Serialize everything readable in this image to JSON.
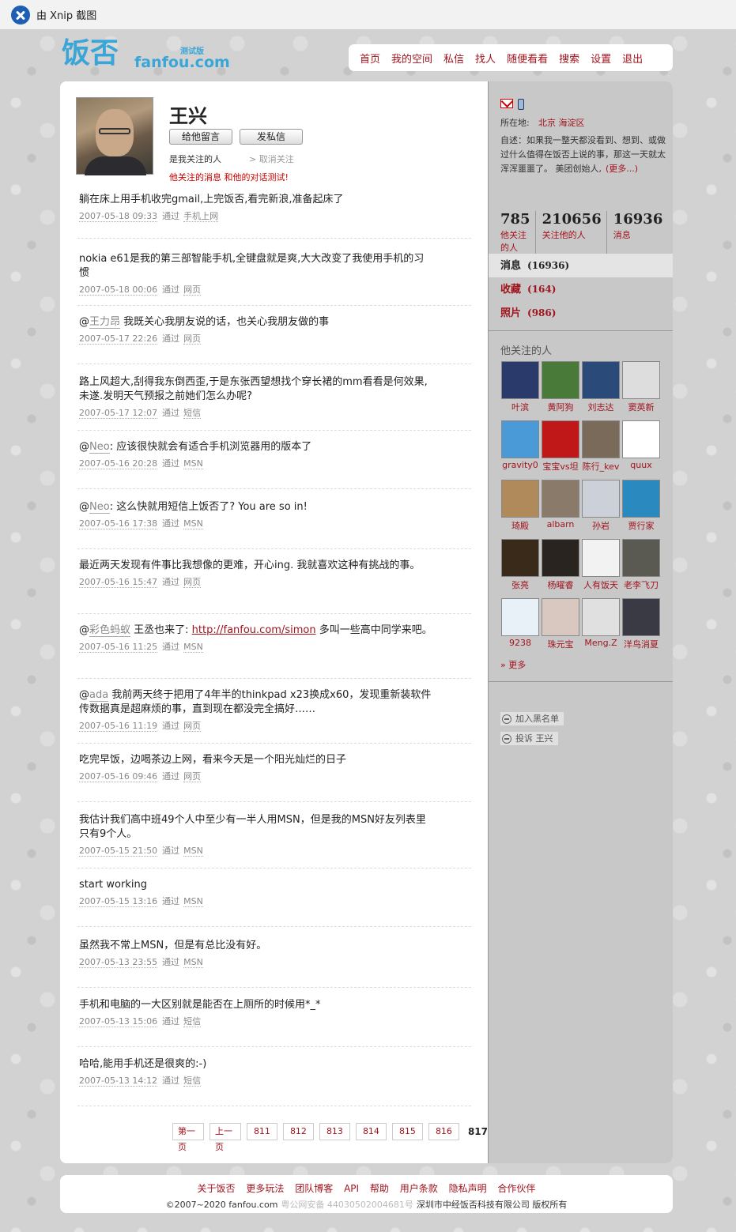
{
  "xnip": {
    "title": "由 Xnip 截图"
  },
  "logo": {
    "cn": "饭否",
    "en": "fanfou.com",
    "beta": "测试版"
  },
  "nav": [
    "首页",
    "我的空间",
    "私信",
    "找人",
    "随便看看",
    "搜索",
    "设置",
    "退出"
  ],
  "profile": {
    "name": "王兴",
    "btn_message": "给他留言",
    "btn_dm": "发私信",
    "follow_status": "是我关注的人",
    "unfollow": "> 取消关注",
    "follow_note": "他关注的消息 和他的对话测试!"
  },
  "statuses": [
    {
      "text": "躺在床上用手机收完gmail,上完饭否,看完新浪,准备起床了",
      "date": "2007-05-18 09:33",
      "via": "通过",
      "src": "手机上网"
    },
    {
      "text": "nokia e61是我的第三部智能手机,全键盘就是爽,大大改变了我使用手机的习惯",
      "date": "2007-05-18 00:06",
      "via": "通过",
      "src": "网页"
    },
    {
      "mention": "王力昂",
      "text": " 我既关心我朋友说的话，也关心我朋友做的事",
      "date": "2007-05-17 22:26",
      "via": "通过",
      "src": "网页"
    },
    {
      "text": "路上风超大,刮得我东倒西歪,于是东张西望想找个穿长裙的mm看看是何效果,未遂.发明天气预报之前她们怎么办呢?",
      "date": "2007-05-17 12:07",
      "via": "通过",
      "src": "短信"
    },
    {
      "mention": "Neo",
      "text": ": 应该很快就会有适合手机浏览器用的版本了",
      "date": "2007-05-16 20:28",
      "via": "通过",
      "src": "MSN"
    },
    {
      "mention": "Neo",
      "text": ": 这么快就用短信上饭否了? You are so in!",
      "date": "2007-05-16 17:38",
      "via": "通过",
      "src": "MSN"
    },
    {
      "text": "最近两天发现有件事比我想像的更难，开心ing. 我就喜欢这种有挑战的事。",
      "date": "2007-05-16 15:47",
      "via": "通过",
      "src": "网页"
    },
    {
      "mention": "彩色蚂蚁",
      "text": " 王丞也来了: ",
      "link": "http://fanfou.com/simon",
      "text2": " 多叫一些高中同学来吧。",
      "date": "2007-05-16 11:25",
      "via": "通过",
      "src": "MSN"
    },
    {
      "mention": "ada",
      "text": " 我前两天终于把用了4年半的thinkpad x23换成x60，发现重新装软件传数据真是超麻烦的事，直到现在都没完全搞好……",
      "date": "2007-05-16 11:19",
      "via": "通过",
      "src": "网页"
    },
    {
      "text": "吃完早饭，边喝茶边上网，看来今天是一个阳光灿烂的日子",
      "date": "2007-05-16 09:46",
      "via": "通过",
      "src": "网页"
    },
    {
      "text": "我估计我们高中班49个人中至少有一半人用MSN，但是我的MSN好友列表里只有9个人。",
      "date": "2007-05-15 21:50",
      "via": "通过",
      "src": "MSN"
    },
    {
      "text": "start working",
      "date": "2007-05-15 13:16",
      "via": "通过",
      "src": "MSN"
    },
    {
      "text": "虽然我不常上MSN，但是有总比没有好。",
      "date": "2007-05-13 23:55",
      "via": "通过",
      "src": "MSN"
    },
    {
      "text": "手机和电脑的一大区别就是能否在上厕所的时候用*_*",
      "date": "2007-05-13 15:06",
      "via": "通过",
      "src": "短信"
    },
    {
      "text": "哈哈,能用手机还是很爽的:-)",
      "date": "2007-05-13 14:12",
      "via": "通过",
      "src": "短信"
    }
  ],
  "pager": {
    "first": "第一页",
    "prev": "上一页",
    "pages": [
      "811",
      "812",
      "813",
      "814",
      "815",
      "816"
    ],
    "current": "817"
  },
  "sidebar": {
    "location_label": "所在地:",
    "location": "北京 海淀区",
    "bio": "自述：如果我一整天都没看到、想到、或做过什么值得在饭否上说的事，那这一天就太浑浑噩噩了。 美团创始人,",
    "bio_more": "(更多...)",
    "stats": [
      {
        "n": "785",
        "l": "他关注的人"
      },
      {
        "n": "210656",
        "l": "关注他的人"
      },
      {
        "n": "16936",
        "l": "消息"
      }
    ],
    "menu": [
      {
        "label": "消息",
        "count": "(16936)"
      },
      {
        "label": "收藏",
        "count": "(164)"
      },
      {
        "label": "照片",
        "count": "(986)"
      }
    ],
    "friends_title": "他关注的人",
    "friends": [
      {
        "name": "叶滨",
        "color": "#2a3a6a"
      },
      {
        "name": "黄阿狗",
        "color": "#4a7a3a"
      },
      {
        "name": "刘志达",
        "color": "#2a4a7a"
      },
      {
        "name": "窦英新",
        "color": "#dddddd"
      },
      {
        "name": "gravity0",
        "color": "#4a9ad8"
      },
      {
        "name": "宝宝vs坦",
        "color": "#c01818"
      },
      {
        "name": "陈行_kev",
        "color": "#7a6a5a"
      },
      {
        "name": "quux",
        "color": "#ffffff"
      },
      {
        "name": "琦殿",
        "color": "#b08a5a"
      },
      {
        "name": "albarn",
        "color": "#8a7a6a"
      },
      {
        "name": "孙岩",
        "color": "#ccd0d8"
      },
      {
        "name": "贾行家",
        "color": "#2a8ac0"
      },
      {
        "name": "张亮",
        "color": "#3a2a1a"
      },
      {
        "name": "杨曜睿",
        "color": "#2a2420"
      },
      {
        "name": "人有饭天",
        "color": "#f2f2f2"
      },
      {
        "name": "老李飞刀",
        "color": "#5a5a52"
      },
      {
        "name": "9238",
        "color": "#e8f0f8"
      },
      {
        "name": "珠元宝",
        "color": "#d8c8c0"
      },
      {
        "name": "Meng.Z",
        "color": "#e0e0e0"
      },
      {
        "name": "洋鸟消夏",
        "color": "#3a3a44"
      }
    ],
    "more_friends": "» 更多",
    "blacklist": "加入黑名单",
    "report": "投诉 王兴"
  },
  "footer": {
    "links": [
      "关于饭否",
      "更多玩法",
      "团队博客",
      "API",
      "帮助",
      "用户条款",
      "隐私声明",
      "合作伙伴"
    ],
    "copyright": "©2007~2020 fanfou.com",
    "icp": "粤公网安备 44030502004681号",
    "company": "深圳市中经饭否科技有限公司 版权所有"
  }
}
